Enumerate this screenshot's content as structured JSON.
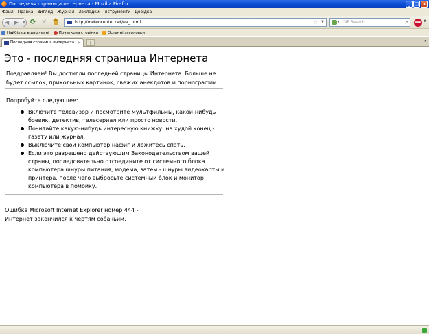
{
  "window": {
    "title": "Последняя страница интернета - Mozilla Firefox",
    "controls": {
      "minimize": "_",
      "maximize": "□",
      "close": "×"
    }
  },
  "menu": [
    "Файл",
    "Правка",
    "Вигляд",
    "Журнал",
    "Закладки",
    "Інструменти",
    "Довідка"
  ],
  "nav": {
    "back_icon": "back-arrow-icon",
    "forward_icon": "forward-arrow-icon",
    "reload_icon": "reload-icon",
    "stop_icon": "stop-icon",
    "home_icon": "home-icon",
    "url": "http://meteocenter.net/ee_.html",
    "search_placeholder": "QIP Search",
    "addon_label": "ABP"
  },
  "bookmarks": [
    {
      "label": "Найбільш відвідувані",
      "icon": "blue"
    },
    {
      "label": "Початкова сторінка",
      "icon": "red"
    },
    {
      "label": "Останні заголовки",
      "icon": "feed"
    }
  ],
  "tabs": [
    {
      "label": "Последняя страница интернета",
      "active": true
    }
  ],
  "page": {
    "heading": "Это - последняя страница Интернета",
    "intro": "Поздравляем! Вы достигли последней страницы Интернета. Больше не будет ссылок, прикольных картинок, свежих анекдотов и порнографии.",
    "try_label": "Попробуйте следующее:",
    "suggestions": [
      "Включите телевизор и посмотрите мультфильмы, какой-нибудь боевик, детектив, телесериал или просто новости.",
      "Почитайте какую-нибудь интересную книжку, на худой конец - газету или журнал.",
      "Выключите свой компьютер нафиг и ложитесь спать.",
      "Если это разрешено действующим Законодательством вашей страны, последовательно отсоедините от системного блока компьютера шнуры питания, модема, затем - шнуры видеокарты и принтера, после чего выбросьте системный блок и монитор компьютера в помойку."
    ],
    "error_line1": "Ошибка Microsoft Internet Explorer номер 444 -",
    "error_line2": "Интернет закончился к чертям собачьим."
  }
}
